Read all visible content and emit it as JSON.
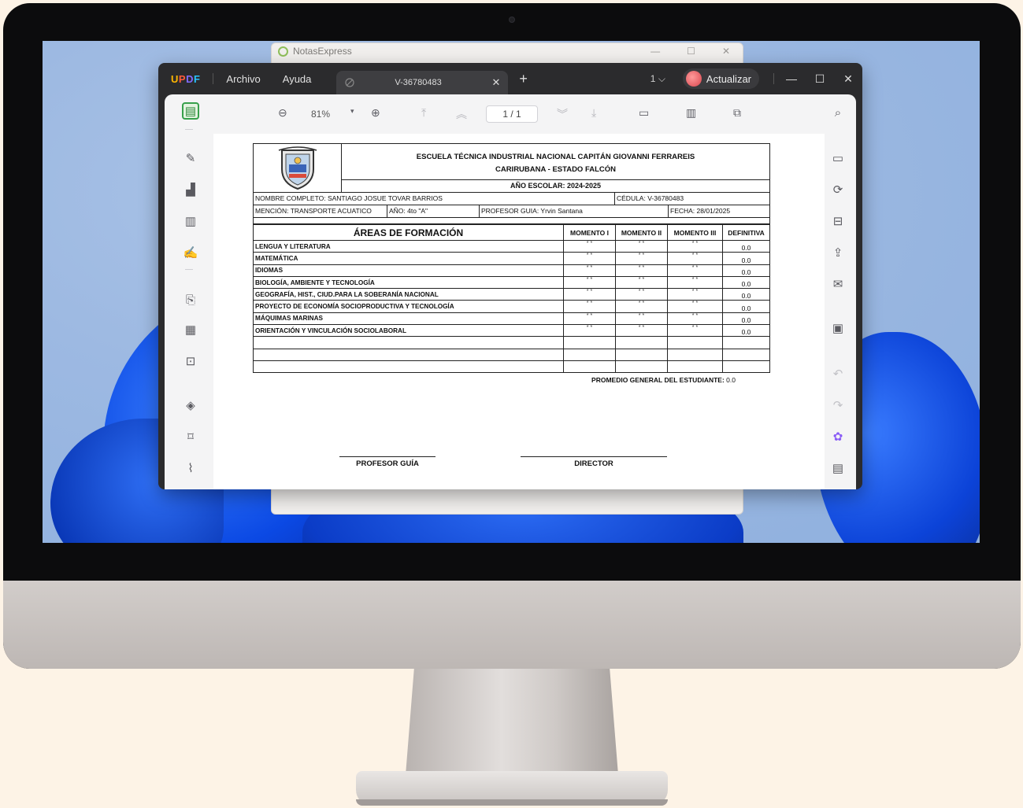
{
  "background_window": {
    "title": "NotasExpress"
  },
  "app": {
    "name": "UPDF",
    "menus": [
      "Archivo",
      "Ayuda"
    ],
    "tab_title": "V-36780483",
    "page_count_badge": "1",
    "upgrade_label": "Actualizar"
  },
  "toolbar": {
    "zoom_value": "81%",
    "page_indicator": "1 / 1"
  },
  "document": {
    "school_line1": "ESCUELA TÉCNICA INDUSTRIAL NACIONAL CAPITÁN GIOVANNI FERRAREIS",
    "school_line2": "CARIRUBANA - ESTADO FALCÓN",
    "school_year": "AÑO ESCOLAR: 2024-2025",
    "student_name": "NOMBRE COMPLETO: SANTIAGO JOSUE TOVAR BARRIOS",
    "cedula": "CÉDULA: V-36780483",
    "mention": "MENCIÓN: TRANSPORTE ACUATICO",
    "year": "AÑO:  4to \"A\"",
    "guide_teacher": "PROFESOR GUIA: Yrvin Santana",
    "date": "FECHA: 28/01/2025",
    "table_headers": [
      "ÁREAS DE FORMACIÓN",
      "MOMENTO I",
      "MOMENTO II",
      "MOMENTO III",
      "DEFINITIVA"
    ],
    "subjects": [
      {
        "name": "LENGUA Y LITERATURA",
        "m1": "* *",
        "m2": "* *",
        "m3": "* *",
        "def": "0.0"
      },
      {
        "name": "MATEMÁTICA",
        "m1": "* *",
        "m2": "* *",
        "m3": "* *",
        "def": "0.0"
      },
      {
        "name": "IDIOMAS",
        "m1": "* *",
        "m2": "* *",
        "m3": "* *",
        "def": "0.0"
      },
      {
        "name": "BIOLOGÍA, AMBIENTE Y TECNOLOGÍA",
        "m1": "* *",
        "m2": "* *",
        "m3": "* *",
        "def": "0.0"
      },
      {
        "name": "GEOGRAFÍA, HIST., CIUD.PARA LA SOBERANÍA NACIONAL",
        "m1": "* *",
        "m2": "* *",
        "m3": "* *",
        "def": "0.0"
      },
      {
        "name": "PROYECTO DE ECONOMÍA SOCIOPRODUCTIVA Y TECNOLOGÍA",
        "m1": "* *",
        "m2": "* *",
        "m3": "* *",
        "def": "0.0"
      },
      {
        "name": "MÁQUIMAS MARINAS",
        "m1": "* *",
        "m2": "* *",
        "m3": "* *",
        "def": "0.0"
      },
      {
        "name": "ORIENTACIÓN Y VINCULACIÓN SOCIOLABORAL",
        "m1": "* *",
        "m2": "* *",
        "m3": "* *",
        "def": "0.0"
      }
    ],
    "average_label": "PROMEDIO GENERAL DEL ESTUDIANTE:",
    "average_value": "0.0",
    "signature_left": "PROFESOR GUÍA",
    "signature_right": "DIRECTOR"
  },
  "icons": {
    "left_rail": [
      "reader-icon",
      "comment-icon",
      "edit-pdf-icon",
      "organize-pages-icon",
      "fill-sign-icon",
      "convert-icon",
      "compress-icon",
      "protect-icon",
      "layers-icon",
      "bookmark-icon",
      "attachment-icon"
    ],
    "right_rail": [
      "search-icon",
      "ocr-icon",
      "convert-file-icon",
      "protect-file-icon",
      "share-icon",
      "email-icon",
      "save-icon",
      "undo-icon",
      "redo-icon",
      "ai-assistant-icon",
      "comment-panel-icon"
    ]
  }
}
